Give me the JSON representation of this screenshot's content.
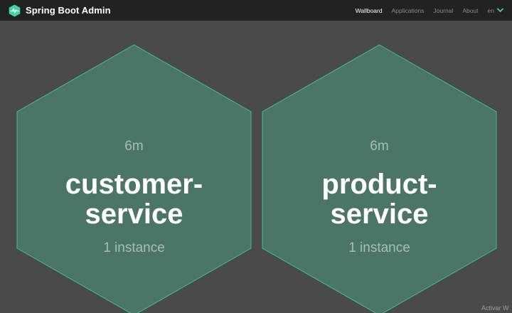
{
  "brand": {
    "name": "Spring Boot Admin"
  },
  "nav": {
    "items": [
      {
        "label": "Wallboard",
        "active": true
      },
      {
        "label": "Applications",
        "active": false
      },
      {
        "label": "Journal",
        "active": false
      },
      {
        "label": "About",
        "active": false
      }
    ],
    "language": "en"
  },
  "applications": [
    {
      "time": "6m",
      "name_line1": "customer-",
      "name_line2": "service",
      "instances": "1 instance",
      "status_color": "#4b7567"
    },
    {
      "time": "6m",
      "name_line1": "product-",
      "name_line2": "service",
      "instances": "1 instance",
      "status_color": "#4b7567"
    }
  ],
  "colors": {
    "navbar": "#222222",
    "background": "#4a4a4a",
    "hex_fill": "#4b7567",
    "hex_stroke": "#3fbf8f",
    "accent": "#42d3a5"
  },
  "watermark": "Activar W"
}
